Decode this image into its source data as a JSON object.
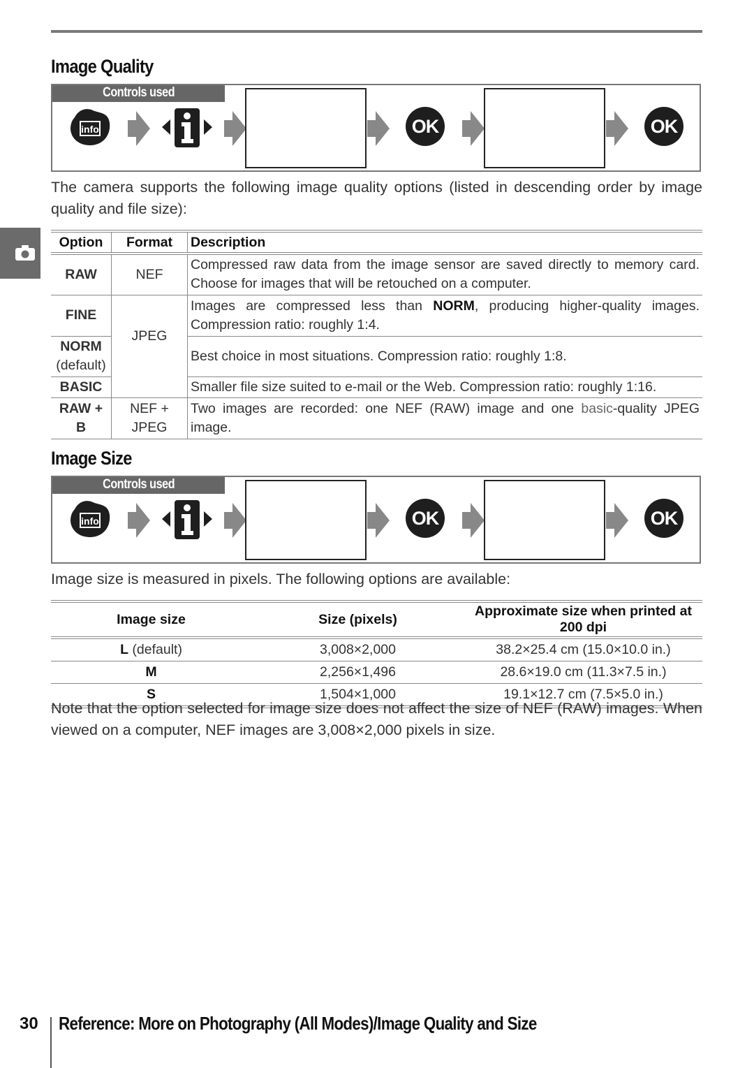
{
  "image_quality": {
    "title": "Image Quality",
    "controls_label": "Controls used",
    "controls": {
      "info_button_label": "info",
      "ok_label": "OK",
      "icons": [
        "info-button-icon",
        "arrow-right-icon",
        "info-i-multiselector-icon",
        "arrow-right-icon",
        "menu-screen",
        "arrow-right-icon",
        "ok-button-icon",
        "arrow-right-icon",
        "menu-screen",
        "arrow-right-icon",
        "ok-button-icon"
      ]
    },
    "intro": "The camera supports the following image quality options (listed in descending order by image quality and file size):",
    "table": {
      "headers": [
        "Option",
        "Format",
        "Description"
      ],
      "rows": [
        {
          "option": "RAW",
          "format": "NEF",
          "description": "Compressed raw data from the image sensor are saved directly to memory card. Choose for images that will be retouched on a computer."
        },
        {
          "option": "FINE",
          "format": "JPEG",
          "description_pre": "Images are compressed less than ",
          "description_bold": "NORM",
          "description_post": ", producing higher-quality images.  Compression ratio: roughly 1:4."
        },
        {
          "option": "NORM",
          "option_note": "(default)",
          "description": "Best choice in most situations.  Compression ratio: roughly 1:8."
        },
        {
          "option": "BASIC",
          "description": "Smaller file size suited to e-mail or the Web.  Compression ratio: roughly 1:16."
        },
        {
          "option": "RAW + B",
          "format": "NEF + JPEG",
          "description_pre": "Two images are recorded: one NEF (RAW) image and one ",
          "description_basic": "basic",
          "description_post": "-quality JPEG image."
        }
      ]
    }
  },
  "image_size": {
    "title": "Image Size",
    "controls_label": "Controls used",
    "controls": {
      "info_button_label": "info",
      "ok_label": "OK"
    },
    "intro": "Image size is measured in pixels.  The following options are available:",
    "table": {
      "headers": [
        "Image size",
        "Size (pixels)",
        "Approximate size when printed at 200 dpi"
      ],
      "rows": [
        {
          "option": "L",
          "option_note": " (default)",
          "pixels": "3,008×2,000",
          "print": "38.2×25.4 cm (15.0×10.0 in.)"
        },
        {
          "option": "M",
          "option_note": "",
          "pixels": "2,256×1,496",
          "print": "28.6×19.0 cm (11.3×7.5 in.)"
        },
        {
          "option": "S",
          "option_note": "",
          "pixels": "1,504×1,000",
          "print": "19.1×12.7 cm (7.5×5.0 in.)"
        }
      ]
    },
    "note": "Note that the option selected for image size does not affect the size of NEF (RAW) images. When viewed on a computer, NEF images are 3,008×2,000 pixels in size."
  },
  "sidebar_tab": {
    "icon": "camera-icon"
  },
  "footer": {
    "page_number": "30",
    "title": "Reference: More on Photography (All Modes)/Image Quality and Size"
  }
}
